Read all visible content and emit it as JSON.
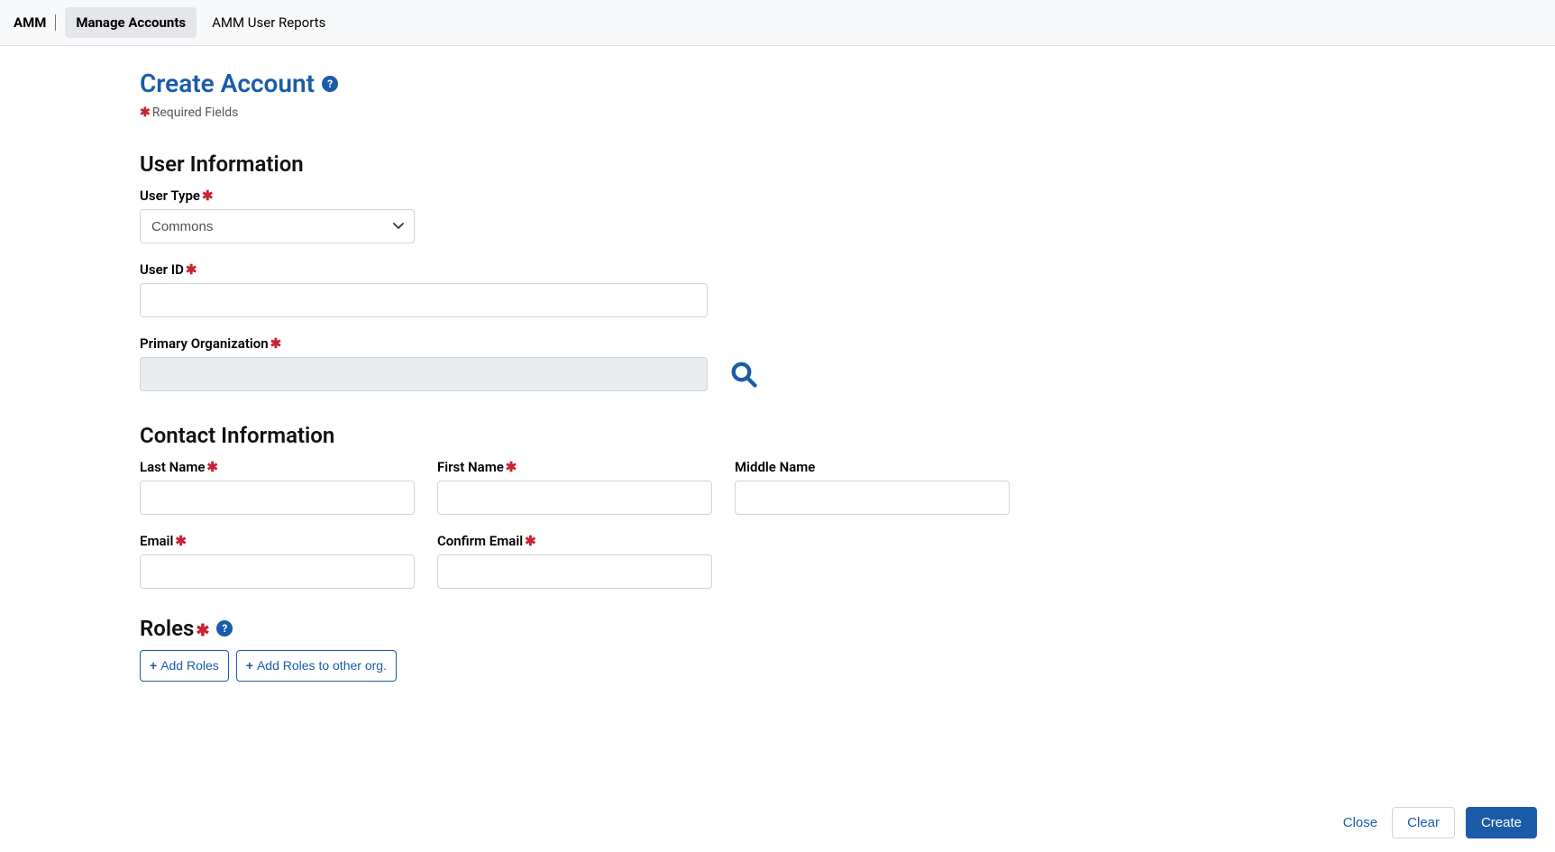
{
  "nav": {
    "brand": "AMM",
    "items": [
      {
        "label": "Manage Accounts",
        "active": true
      },
      {
        "label": "AMM User Reports",
        "active": false
      }
    ]
  },
  "page": {
    "title": "Create Account",
    "required_note": "Required Fields"
  },
  "sections": {
    "user_info_heading": "User Information",
    "contact_info_heading": "Contact Information",
    "roles_heading": "Roles"
  },
  "fields": {
    "user_type": {
      "label": "User Type",
      "value": "Commons",
      "options": [
        "Commons"
      ]
    },
    "user_id": {
      "label": "User ID",
      "value": ""
    },
    "primary_org": {
      "label": "Primary Organization",
      "value": ""
    },
    "last_name": {
      "label": "Last Name",
      "value": ""
    },
    "first_name": {
      "label": "First Name",
      "value": ""
    },
    "middle_name": {
      "label": "Middle Name",
      "value": ""
    },
    "email": {
      "label": "Email",
      "value": ""
    },
    "confirm_email": {
      "label": "Confirm Email",
      "value": ""
    }
  },
  "buttons": {
    "add_roles": "Add Roles",
    "add_roles_other_org": "Add Roles to other org.",
    "close": "Close",
    "clear": "Clear",
    "create": "Create"
  }
}
